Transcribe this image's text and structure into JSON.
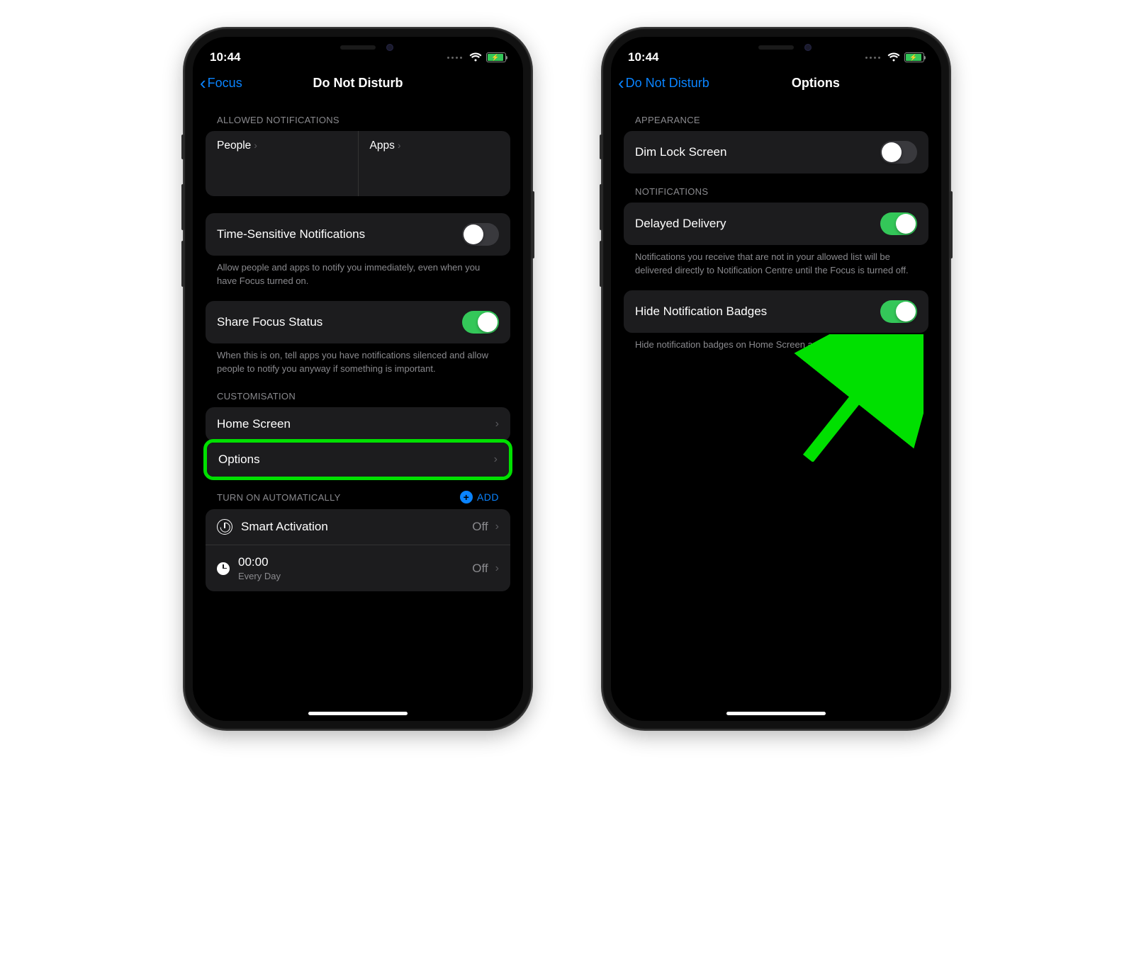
{
  "status": {
    "time": "10:44"
  },
  "phone1": {
    "back": "Focus",
    "title": "Do Not Disturb",
    "sections": {
      "allowed_header": "ALLOWED NOTIFICATIONS",
      "people": "People",
      "apps": "Apps",
      "time_sensitive": "Time-Sensitive Notifications",
      "time_sensitive_desc": "Allow people and apps to notify you immediately, even when you have Focus turned on.",
      "share_focus": "Share Focus Status",
      "share_focus_desc": "When this is on, tell apps you have notifications silenced and allow people to notify you anyway if something is important.",
      "customisation_header": "CUSTOMISATION",
      "home_screen": "Home Screen",
      "options": "Options",
      "auto_header": "TURN ON AUTOMATICALLY",
      "add": "ADD",
      "smart_activation": "Smart Activation",
      "smart_value": "Off",
      "schedule_time": "00:00",
      "schedule_sub": "Every Day",
      "schedule_value": "Off"
    }
  },
  "phone2": {
    "back": "Do Not Disturb",
    "title": "Options",
    "sections": {
      "appearance_header": "APPEARANCE",
      "dim": "Dim Lock Screen",
      "notifications_header": "NOTIFICATIONS",
      "delayed": "Delayed Delivery",
      "delayed_desc": "Notifications you receive that are not in your allowed list will be delivered directly to Notification Centre until the Focus is turned off.",
      "hide_badges": "Hide Notification Badges",
      "hide_badges_desc": "Hide notification badges on Home Screen apps"
    }
  }
}
